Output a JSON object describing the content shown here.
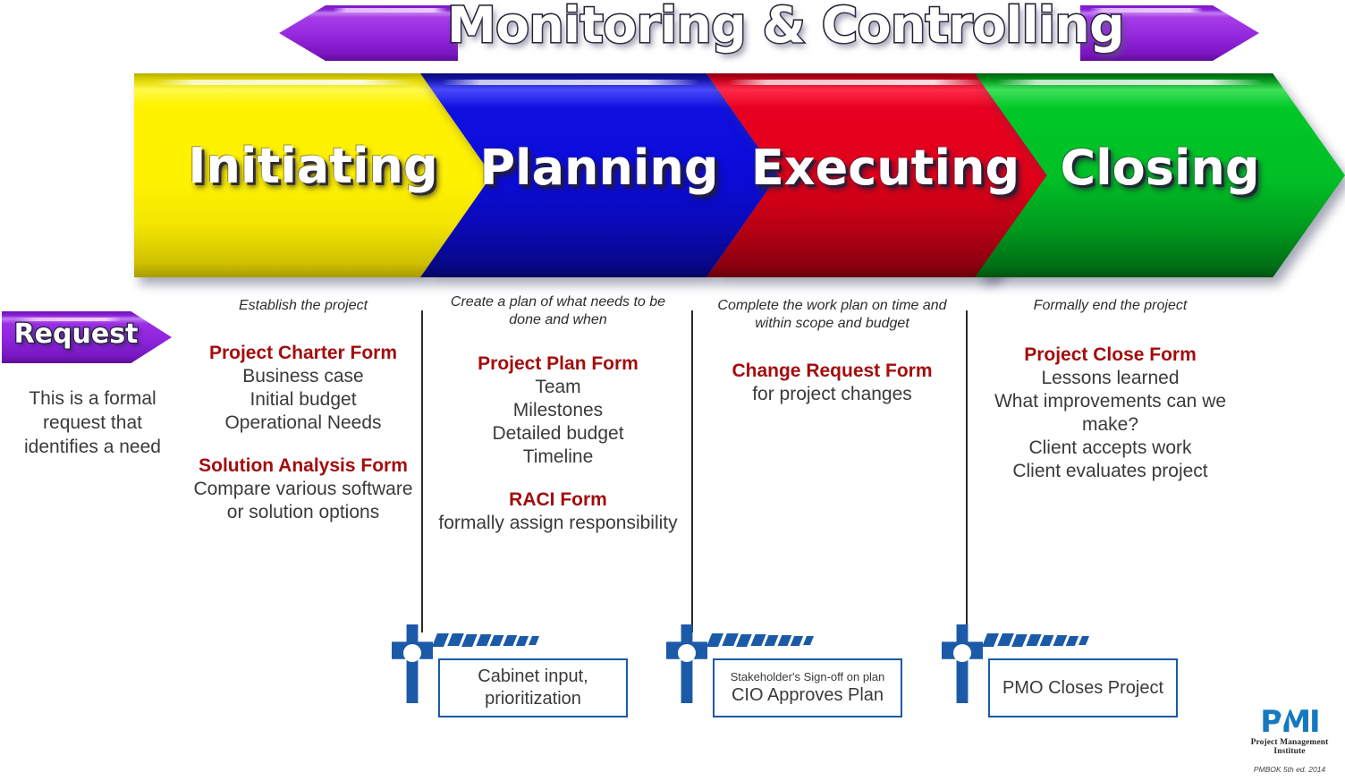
{
  "header": {
    "title": "Monitoring & Controlling",
    "arrow_color": "#8d24dc"
  },
  "phases": [
    {
      "label": "Initiating",
      "color": "#fff200"
    },
    {
      "label": "Planning",
      "color": "#0b0bd8"
    },
    {
      "label": "Executing",
      "color": "#e00018"
    },
    {
      "label": "Closing",
      "color": "#00bf26"
    }
  ],
  "request": {
    "label": "Request",
    "color": "#8d24dc",
    "description": "This is a formal request that identifies a need"
  },
  "columns": [
    {
      "caption": "Establish the project",
      "blocks": [
        {
          "title": "Project Charter Form",
          "lines": "Business case\nInitial budget\nOperational Needs"
        },
        {
          "title": "Solution Analysis Form",
          "lines": "Compare various software or solution options"
        }
      ]
    },
    {
      "caption": "Create a plan of what needs to be done and when",
      "blocks": [
        {
          "title": "Project Plan Form",
          "lines": "Team\nMilestones\nDetailed budget\nTimeline"
        },
        {
          "title": "RACI Form",
          "lines": "formally assign responsibility"
        }
      ]
    },
    {
      "caption": "Complete the work plan on time and within scope and budget",
      "blocks": [
        {
          "title": "Change Request Form",
          "lines": "for project changes"
        }
      ]
    },
    {
      "caption": "Formally end the project",
      "blocks": [
        {
          "title": "Project Close Form",
          "lines": "Lessons learned\nWhat improvements can we make?\nClient accepts work\nClient evaluates project"
        }
      ]
    }
  ],
  "gates": [
    {
      "small": "",
      "text": "Cabinet input, prioritization",
      "color": "#1b5aa8"
    },
    {
      "small": "Stakeholder's Sign-off on plan",
      "text": "CIO Approves Plan",
      "color": "#1b5aa8"
    },
    {
      "small": "",
      "text": "PMO Closes Project",
      "color": "#1b5aa8"
    }
  ],
  "logo": {
    "mark": "PMI",
    "name": "Project Management Institute",
    "caption": "PMBOK 5th ed. 2014",
    "color": "#1679c0"
  }
}
